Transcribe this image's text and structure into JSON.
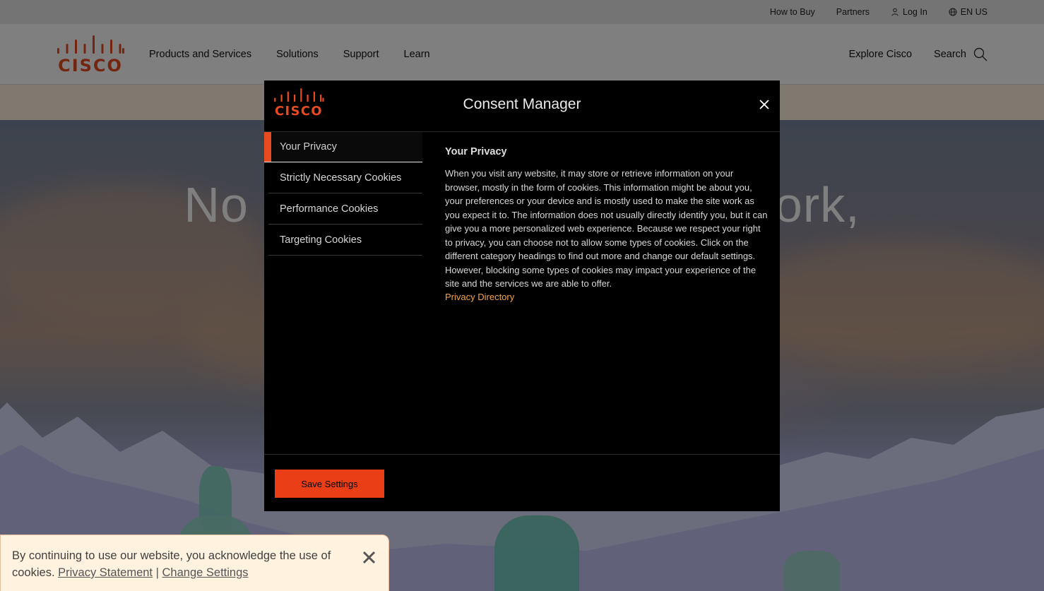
{
  "topbar": {
    "how_to_buy": "How to Buy",
    "partners": "Partners",
    "log_in": "Log In",
    "language": "EN US"
  },
  "nav": {
    "items": [
      "Products and Services",
      "Solutions",
      "Support",
      "Learn"
    ],
    "explore": "Explore Cisco",
    "search": "Search"
  },
  "hero": {
    "headline_left": "No",
    "headline_right": "ork,"
  },
  "modal": {
    "title": "Consent Manager",
    "tabs": [
      "Your Privacy",
      "Strictly Necessary Cookies",
      "Performance Cookies",
      "Targeting Cookies"
    ],
    "content_heading": "Your Privacy",
    "content_body": "When you visit any website, it may store or retrieve information on your browser, mostly in the form of cookies. This information might be about you, your preferences or your device and is mostly used to make the site work as you expect it to. The information does not usually directly identify you, but it can give you a more personalized web experience. Because we respect your right to privacy, you can choose not to allow some types of cookies. Click on the different category headings to find out more and change our default settings. However, blocking some types of cookies may impact your experience of the site and the services we are able to offer.",
    "content_link": "Privacy Directory",
    "save_label": "Save Settings"
  },
  "cookie_banner": {
    "text": "By continuing to use our website, you acknowledge the use of cookies.",
    "privacy_link": "Privacy Statement",
    "separator": "|",
    "settings_link": "Change Settings"
  },
  "colors": {
    "accent": "#ea3f16",
    "cisco_logo_orange": "#e94b20",
    "link_orange": "#f2a44a"
  }
}
